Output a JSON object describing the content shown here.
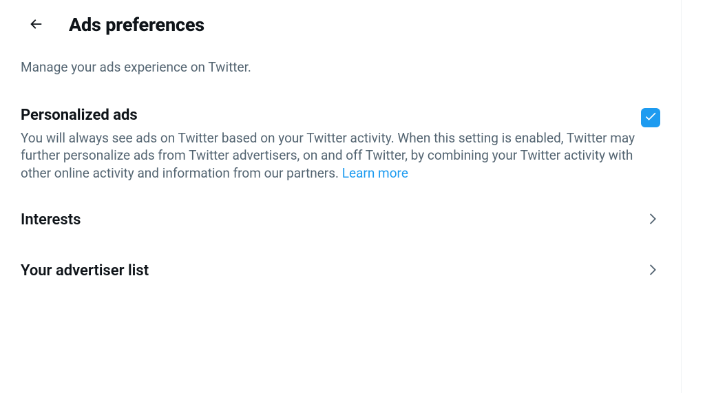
{
  "header": {
    "title": "Ads preferences",
    "description": "Manage your ads experience on Twitter."
  },
  "personalized": {
    "title": "Personalized ads",
    "description_text": "You will always see ads on Twitter based on your Twitter activity. When this setting is enabled, Twitter may further personalize ads from Twitter advertisers, on and off Twitter, by combining your Twitter activity with other online activity and information from our partners. ",
    "learn_more": "Learn more",
    "checked": true
  },
  "nav": {
    "interests": "Interests",
    "advertiser_list": "Your advertiser list"
  }
}
